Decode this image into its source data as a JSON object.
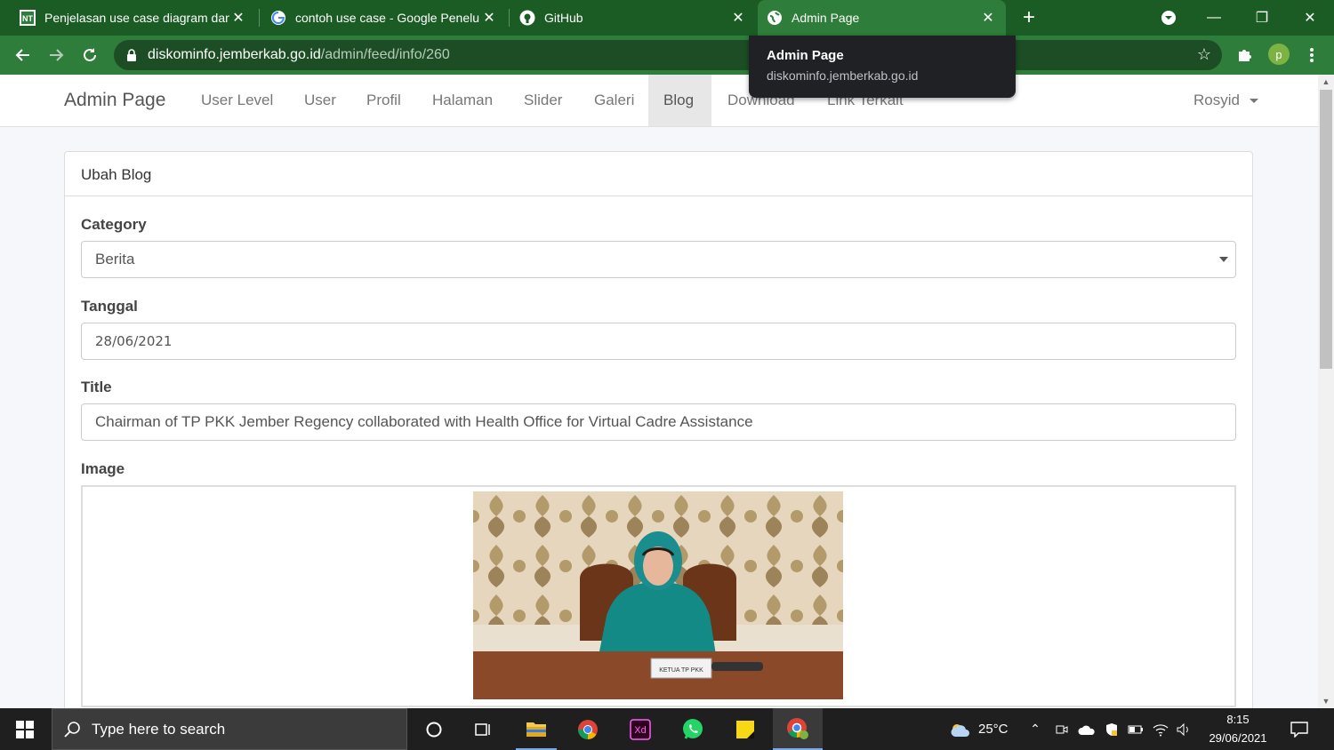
{
  "browser": {
    "tabs": [
      {
        "title": "Penjelasan use case diagram dan",
        "favicon": "site-icon"
      },
      {
        "title": "contoh use case - Google Penelu",
        "favicon": "google-icon"
      },
      {
        "title": "GitHub",
        "favicon": "github-icon"
      },
      {
        "title": "Admin Page",
        "favicon": "globe-icon"
      }
    ],
    "new_tab": "+",
    "url_host": "diskominfo.jemberkab.go.id",
    "url_path": "/admin/feed/info/260",
    "profile_initial": "p",
    "tooltip": {
      "title": "Admin Page",
      "host": "diskominfo.jemberkab.go.id"
    }
  },
  "navbar": {
    "brand": "Admin Page",
    "links": [
      "User Level",
      "User",
      "Profil",
      "Halaman",
      "Slider",
      "Galeri",
      "Blog",
      "Download",
      "Link Terkait"
    ],
    "active": "Blog",
    "user": "Rosyid"
  },
  "form": {
    "heading": "Ubah Blog",
    "category_label": "Category",
    "category_value": "Berita",
    "date_label": "Tanggal",
    "date_value": "28/06/2021",
    "title_label": "Title",
    "title_value": "Chairman of TP PKK Jember Regency collaborated with Health Office for Virtual Cadre Assistance",
    "image_label": "Image",
    "image_caption": "KETUA TP PKK"
  },
  "taskbar": {
    "search_placeholder": "Type here to search",
    "weather": "25°C",
    "time": "8:15",
    "date": "29/06/2021"
  },
  "colors": {
    "tab_strip": "#1b5c25",
    "toolbar": "#2e7d3a"
  }
}
